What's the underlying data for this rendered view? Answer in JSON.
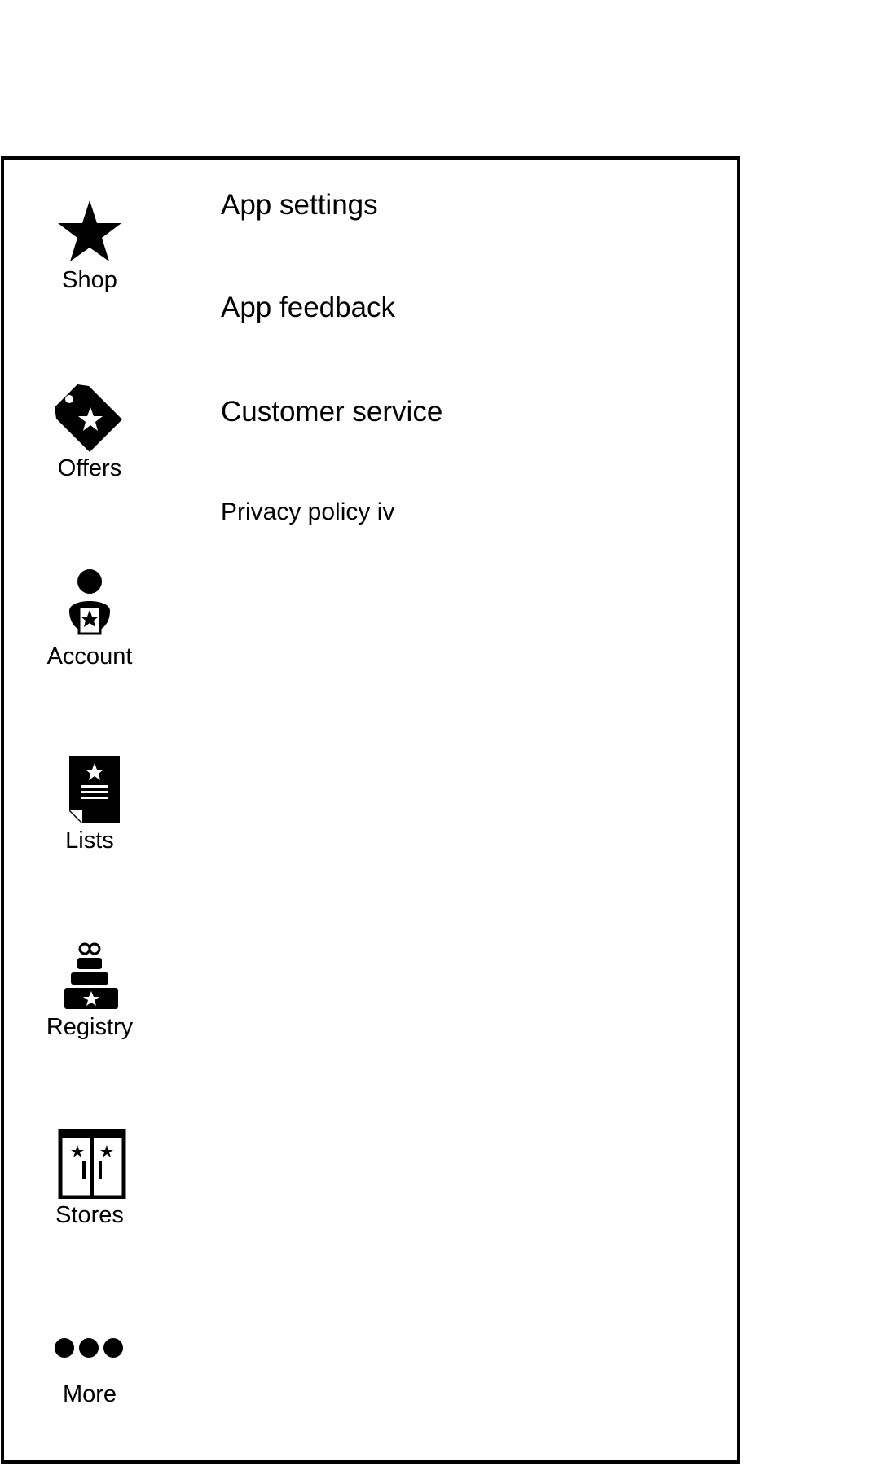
{
  "sidebar": {
    "items": [
      {
        "label": "Shop",
        "icon": "star-icon"
      },
      {
        "label": "Offers",
        "icon": "tag-star-icon"
      },
      {
        "label": "Account",
        "icon": "account-icon"
      },
      {
        "label": "Lists",
        "icon": "list-icon"
      },
      {
        "label": "Registry",
        "icon": "gift-icon"
      },
      {
        "label": "Stores",
        "icon": "store-icon"
      },
      {
        "label": "More",
        "icon": "more-dots-icon"
      }
    ]
  },
  "menu": {
    "items": [
      {
        "label": "App settings"
      },
      {
        "label": "App feedback"
      },
      {
        "label": "Customer service"
      },
      {
        "label": "Privacy policy iv"
      }
    ]
  },
  "colors": {
    "foreground": "#000000",
    "background": "#ffffff"
  }
}
